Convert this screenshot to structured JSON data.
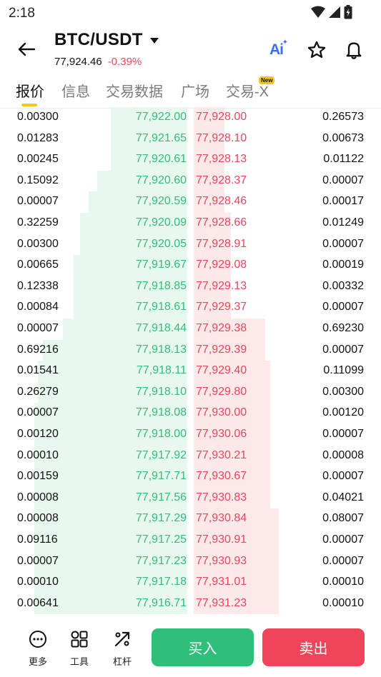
{
  "status": {
    "time": "2:18"
  },
  "header": {
    "pair": "BTC/USDT",
    "last_price": "77,924.46",
    "change": "-0.39%",
    "ai_label": "Ai"
  },
  "tabs": [
    {
      "label": "报价",
      "active": true
    },
    {
      "label": "信息",
      "active": false
    },
    {
      "label": "交易数据",
      "active": false
    },
    {
      "label": "广场",
      "active": false
    },
    {
      "label": "交易-X",
      "active": false,
      "badge": "New"
    }
  ],
  "orderbook": {
    "rows": [
      {
        "bid_qty": "0.00300",
        "bid_price": "77,922.00",
        "ask_price": "77,928.00",
        "ask_qty": "0.26573",
        "bid_depth": 0.45,
        "ask_depth": 0.18
      },
      {
        "bid_qty": "0.01283",
        "bid_price": "77,921.65",
        "ask_price": "77,928.10",
        "ask_qty": "0.00673",
        "bid_depth": 0.45,
        "ask_depth": 0.18
      },
      {
        "bid_qty": "0.00245",
        "bid_price": "77,920.61",
        "ask_price": "77,928.13",
        "ask_qty": "0.01122",
        "bid_depth": 0.45,
        "ask_depth": 0.18
      },
      {
        "bid_qty": "0.15092",
        "bid_price": "77,920.60",
        "ask_price": "77,928.37",
        "ask_qty": "0.00007",
        "bid_depth": 0.53,
        "ask_depth": 0.18
      },
      {
        "bid_qty": "0.00007",
        "bid_price": "77,920.59",
        "ask_price": "77,928.46",
        "ask_qty": "0.00017",
        "bid_depth": 0.58,
        "ask_depth": 0.18
      },
      {
        "bid_qty": "0.32259",
        "bid_price": "77,920.09",
        "ask_price": "77,928.66",
        "ask_qty": "0.01249",
        "bid_depth": 0.63,
        "ask_depth": 0.22
      },
      {
        "bid_qty": "0.00300",
        "bid_price": "77,920.05",
        "ask_price": "77,928.91",
        "ask_qty": "0.00007",
        "bid_depth": 0.63,
        "ask_depth": 0.22
      },
      {
        "bid_qty": "0.00665",
        "bid_price": "77,919.67",
        "ask_price": "77,929.08",
        "ask_qty": "0.00019",
        "bid_depth": 0.67,
        "ask_depth": 0.22
      },
      {
        "bid_qty": "0.12338",
        "bid_price": "77,918.85",
        "ask_price": "77,929.13",
        "ask_qty": "0.00332",
        "bid_depth": 0.67,
        "ask_depth": 0.22
      },
      {
        "bid_qty": "0.00084",
        "bid_price": "77,918.61",
        "ask_price": "77,929.37",
        "ask_qty": "0.00007",
        "bid_depth": 0.67,
        "ask_depth": 0.22
      },
      {
        "bid_qty": "0.00007",
        "bid_price": "77,918.44",
        "ask_price": "77,929.38",
        "ask_qty": "0.69230",
        "bid_depth": 0.73,
        "ask_depth": 0.42
      },
      {
        "bid_qty": "0.69216",
        "bid_price": "77,918.13",
        "ask_price": "77,929.39",
        "ask_qty": "0.00007",
        "bid_depth": 0.85,
        "ask_depth": 0.42
      },
      {
        "bid_qty": "0.01541",
        "bid_price": "77,918.11",
        "ask_price": "77,929.40",
        "ask_qty": "0.11099",
        "bid_depth": 0.88,
        "ask_depth": 0.45
      },
      {
        "bid_qty": "0.26279",
        "bid_price": "77,918.10",
        "ask_price": "77,929.80",
        "ask_qty": "0.00300",
        "bid_depth": 0.88,
        "ask_depth": 0.45
      },
      {
        "bid_qty": "0.00007",
        "bid_price": "77,918.08",
        "ask_price": "77,930.00",
        "ask_qty": "0.00120",
        "bid_depth": 0.9,
        "ask_depth": 0.45
      },
      {
        "bid_qty": "0.00120",
        "bid_price": "77,918.00",
        "ask_price": "77,930.06",
        "ask_qty": "0.00007",
        "bid_depth": 0.9,
        "ask_depth": 0.45
      },
      {
        "bid_qty": "0.00010",
        "bid_price": "77,917.92",
        "ask_price": "77,930.21",
        "ask_qty": "0.00008",
        "bid_depth": 0.9,
        "ask_depth": 0.45
      },
      {
        "bid_qty": "0.00159",
        "bid_price": "77,917.71",
        "ask_price": "77,930.67",
        "ask_qty": "0.00007",
        "bid_depth": 0.9,
        "ask_depth": 0.45
      },
      {
        "bid_qty": "0.00008",
        "bid_price": "77,917.56",
        "ask_price": "77,930.83",
        "ask_qty": "0.04021",
        "bid_depth": 0.9,
        "ask_depth": 0.45
      },
      {
        "bid_qty": "0.00008",
        "bid_price": "77,917.29",
        "ask_price": "77,930.84",
        "ask_qty": "0.08007",
        "bid_depth": 0.9,
        "ask_depth": 0.5
      },
      {
        "bid_qty": "0.09116",
        "bid_price": "77,917.25",
        "ask_price": "77,930.91",
        "ask_qty": "0.00007",
        "bid_depth": 0.9,
        "ask_depth": 0.5
      },
      {
        "bid_qty": "0.00007",
        "bid_price": "77,917.23",
        "ask_price": "77,930.93",
        "ask_qty": "0.00007",
        "bid_depth": 0.9,
        "ask_depth": 0.5
      },
      {
        "bid_qty": "0.00010",
        "bid_price": "77,917.18",
        "ask_price": "77,931.01",
        "ask_qty": "0.00010",
        "bid_depth": 0.9,
        "ask_depth": 0.5
      },
      {
        "bid_qty": "0.00641",
        "bid_price": "77,916.71",
        "ask_price": "77,931.23",
        "ask_qty": "0.00010",
        "bid_depth": 0.9,
        "ask_depth": 0.5
      }
    ]
  },
  "bottom": {
    "more_label": "更多",
    "tools_label": "工具",
    "leverage_label": "杠杆",
    "buy_label": "买入",
    "sell_label": "卖出"
  },
  "colors": {
    "buy": "#2fbf7a",
    "sell": "#f0445b",
    "accent": "#f5c518"
  }
}
